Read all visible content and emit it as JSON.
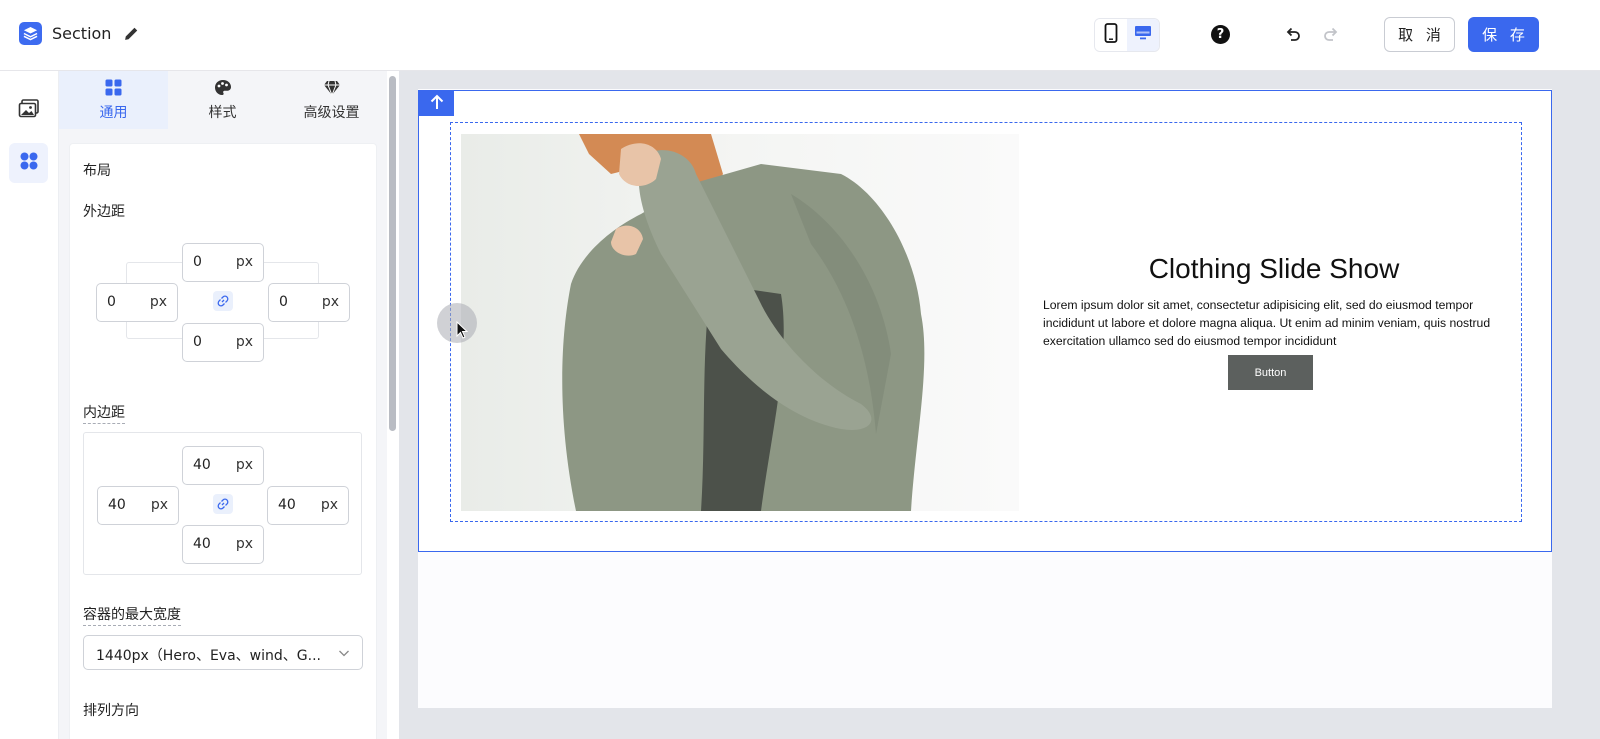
{
  "header": {
    "title": "Section",
    "cancel_label": "取 消",
    "save_label": "保 存",
    "help_label": "?"
  },
  "tabs": [
    {
      "label": "通用",
      "icon": "grid-icon",
      "active": true
    },
    {
      "label": "样式",
      "icon": "palette-icon",
      "active": false
    },
    {
      "label": "高级设置",
      "icon": "gem-icon",
      "active": false
    }
  ],
  "layout": {
    "heading": "布局",
    "margin_label": "外边距",
    "margin": {
      "top": "0",
      "left": "0",
      "right": "0",
      "bottom": "0",
      "unit": "px"
    },
    "padding_label": "内边距",
    "padding": {
      "top": "40",
      "left": "40",
      "right": "40",
      "bottom": "40",
      "unit": "px"
    },
    "max_width_label": "容器的最大宽度",
    "max_width_value": "1440px（Hero、Eva、wind、G...",
    "direction_label": "排列方向"
  },
  "hero": {
    "title": "Clothing Slide Show",
    "description": "Lorem ipsum dolor sit amet, consectetur adipisicing elit, sed do eiusmod tempor incididunt ut labore et dolore magna aliqua. Ut enim ad minim veniam, quis nostrud exercitation ullamco sed do eiusmod tempor incididunt",
    "button_label": "Button"
  },
  "colors": {
    "accent": "#3a68ee",
    "hero_button": "#5c605e",
    "sweater": "#8d9784"
  }
}
